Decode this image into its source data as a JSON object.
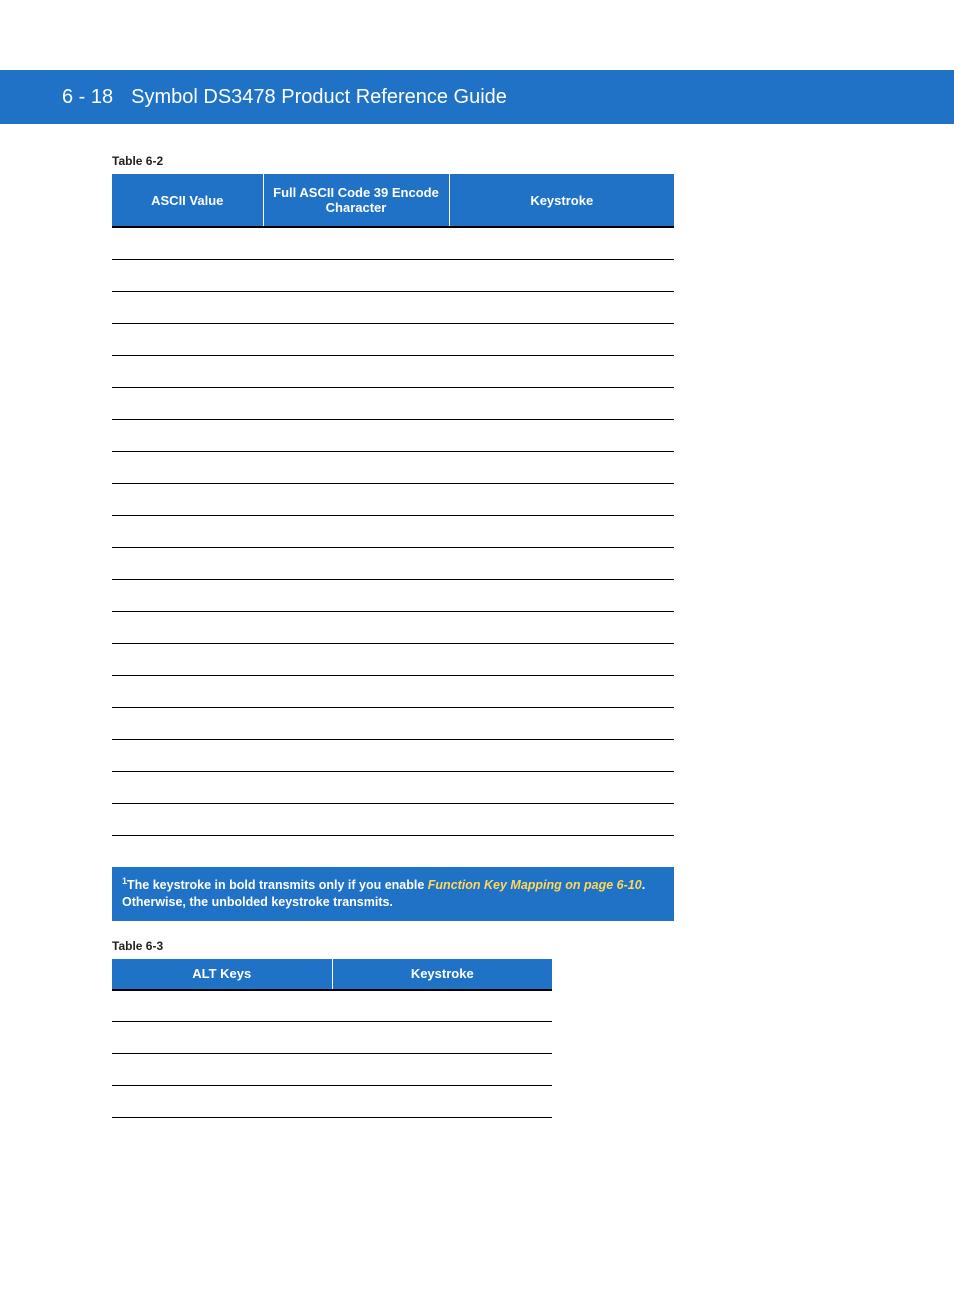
{
  "header": {
    "page_marker": "6 - 18",
    "title": "Symbol DS3478 Product Reference Guide"
  },
  "table1": {
    "label": "Table 6-2",
    "columns": [
      "ASCII Value",
      "Full ASCII Code 39 Encode Character",
      "Keystroke"
    ],
    "rows": [
      [
        "",
        "",
        ""
      ],
      [
        "",
        "",
        ""
      ],
      [
        "",
        "",
        ""
      ],
      [
        "",
        "",
        ""
      ],
      [
        "",
        "",
        ""
      ],
      [
        "",
        "",
        ""
      ],
      [
        "",
        "",
        ""
      ],
      [
        "",
        "",
        ""
      ],
      [
        "",
        "",
        ""
      ],
      [
        "",
        "",
        ""
      ],
      [
        "",
        "",
        ""
      ],
      [
        "",
        "",
        ""
      ],
      [
        "",
        "",
        ""
      ],
      [
        "",
        "",
        ""
      ],
      [
        "",
        "",
        ""
      ],
      [
        "",
        "",
        ""
      ],
      [
        "",
        "",
        ""
      ],
      [
        "",
        "",
        ""
      ],
      [
        "",
        "",
        ""
      ],
      [
        "",
        "",
        ""
      ]
    ],
    "footnote_pre": "The keystroke in bold transmits only if you enable ",
    "footnote_link": "Function Key Mapping on page 6-10",
    "footnote_post": ". Otherwise, the unbolded keystroke transmits."
  },
  "table2": {
    "label": "Table 6-3",
    "columns": [
      "ALT Keys",
      "Keystroke"
    ],
    "rows": [
      [
        "",
        ""
      ],
      [
        "",
        ""
      ],
      [
        "",
        ""
      ],
      [
        "",
        ""
      ],
      [
        "",
        ""
      ]
    ]
  }
}
